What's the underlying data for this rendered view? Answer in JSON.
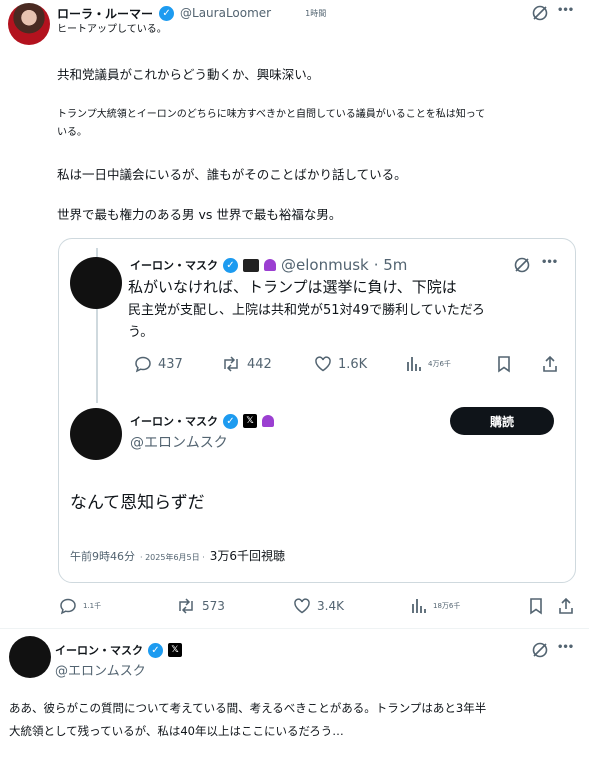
{
  "main_post": {
    "author_name": "ローラ・ルーマー",
    "author_handle": "@LauraLoomer",
    "time": "1時間",
    "line1": "ヒートアップしている。",
    "para1": "共和党議員がこれからどう動くか、興味深い。",
    "para2_line1": "トランプ大統領とイーロンのどちらに味方すべきかと自問している議員がいることを私は知って",
    "para2_line2": "いる。",
    "para3": "私は一日中議会にいるが、誰もがそのことばかり話している。",
    "para4": "世界で最も権力のある男 vs 世界で最も裕福な男。",
    "actions": {
      "replies": "1.1千",
      "reposts": "573",
      "likes": "3.4K",
      "views": "18万6千"
    }
  },
  "quote": {
    "inner": {
      "author_name": "イーロン・マスク",
      "author_handle": "@elonmusk",
      "time": "· 5m",
      "line1": "私がいなければ、トランプは選挙に負け、下院は",
      "line2": "民主党が支配し、上院は共和党が51対49で勝利していただろ",
      "line3": "う。",
      "actions": {
        "replies": "437",
        "reposts": "442",
        "likes": "1.6K",
        "views": "4万6千"
      }
    },
    "outer": {
      "author_name": "イーロン・マスク",
      "author_handle": "@エロンムスク",
      "subscribe_label": "購読",
      "text": "なんて恩知らずだ",
      "meta_time": "午前9時46分",
      "meta_date": "· 2025年6月5日 ·",
      "meta_views": "3万6千回視聴"
    }
  },
  "reply_post": {
    "author_name": "イーロン・マスク",
    "author_handle": "@エロンムスク",
    "line1": "ああ、彼らがこの質問について考えている間、考えるべきことがある。トランプはあと3年半",
    "line2": "大統領として残っているが、私は40年以上はここにいるだろう…"
  },
  "icons": {
    "verified": "✓",
    "x_badge": "𝕏",
    "more": "•••"
  },
  "colors": {
    "verified_blue": "#1d9bf0",
    "text": "#0f1419",
    "muted": "#536471",
    "border": "#cfd9de"
  }
}
